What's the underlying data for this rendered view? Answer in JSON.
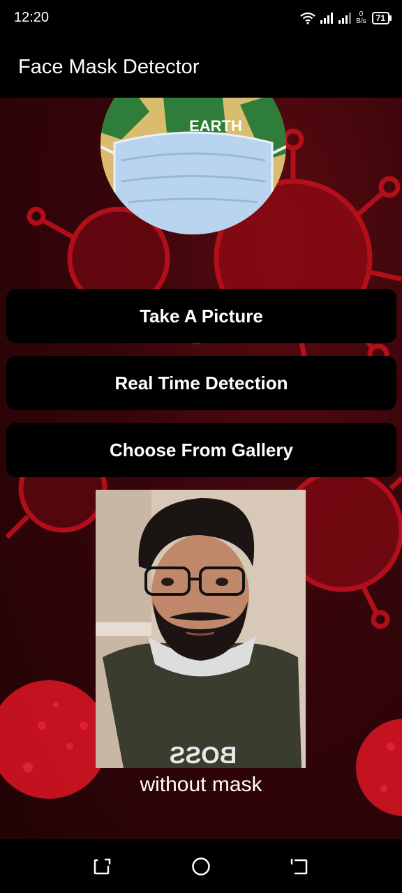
{
  "status_bar": {
    "time": "12:20",
    "net_speed_value": "0",
    "net_speed_unit": "B/s",
    "battery_level": "71"
  },
  "app_bar": {
    "title": "Face Mask Detector"
  },
  "logo": {
    "text": "EARTH"
  },
  "buttons": {
    "take_picture": "Take A Picture",
    "real_time_detection": "Real Time Detection",
    "choose_from_gallery": "Choose From Gallery"
  },
  "result": {
    "label": "without mask",
    "shirt_text": "BOSS"
  },
  "colors": {
    "accent_red": "#d41424",
    "background": "#3a0508",
    "button": "#000000"
  },
  "nav_bar": {
    "icons": [
      "recent-apps-icon",
      "home-icon",
      "back-icon"
    ]
  }
}
